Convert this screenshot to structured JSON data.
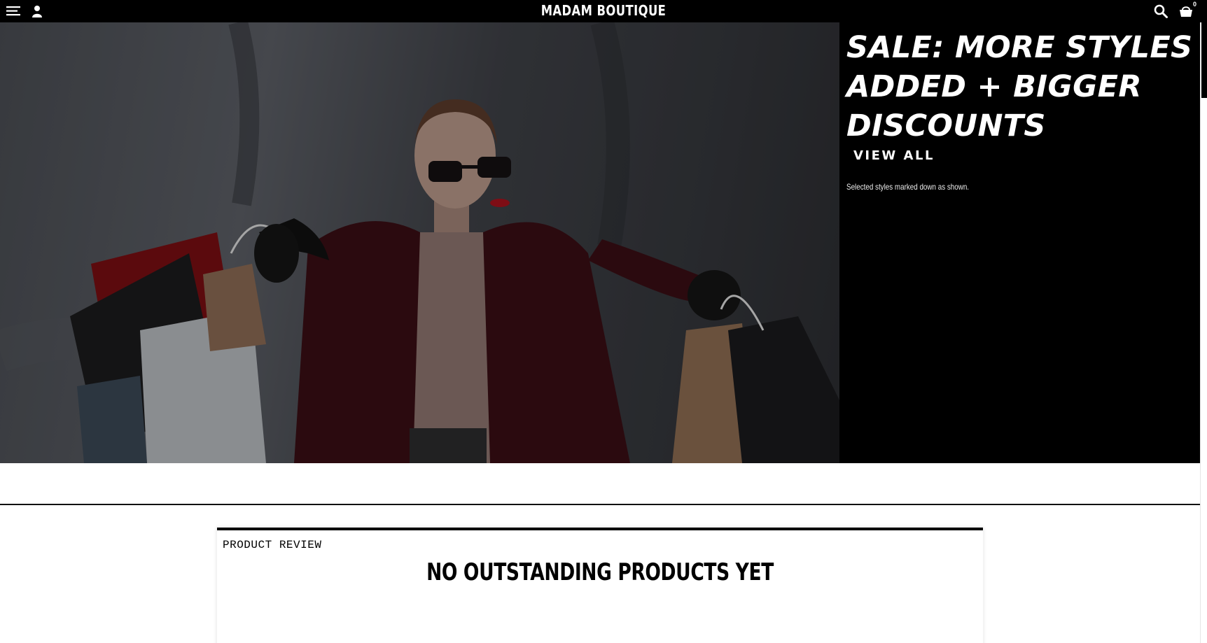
{
  "header": {
    "brand": "MADAM BOUTIQUE",
    "cart_count": "0",
    "icons": [
      "menu-icon",
      "user-icon",
      "search-icon",
      "cart-icon"
    ]
  },
  "hero": {
    "headline": "SALE: MORE STYLES ADDED + BIGGER DISCOUNTS",
    "cta_label": "VIEW ALL",
    "fine_print": "Selected styles marked down as shown."
  },
  "review": {
    "label": "PRODUCT REVIEW",
    "title": "NO OUTSTANDING PRODUCTS YET"
  },
  "colors": {
    "header_bg": "#000000",
    "panel_bg": "#000000",
    "text_light": "#ffffff"
  }
}
